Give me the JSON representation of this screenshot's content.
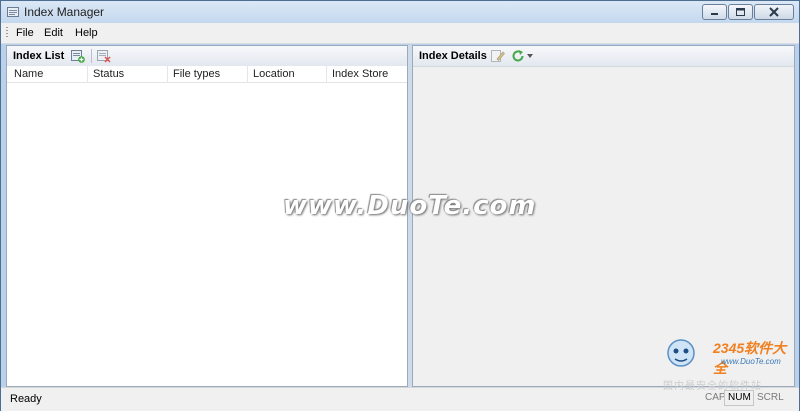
{
  "window": {
    "title": "Index Manager"
  },
  "menu": {
    "items": [
      "File",
      "Edit",
      "Help"
    ]
  },
  "left_pane": {
    "title": "Index List",
    "columns": [
      "Name",
      "Status",
      "File types",
      "Location",
      "Index Store"
    ]
  },
  "right_pane": {
    "title": "Index Details"
  },
  "status_bar": {
    "text": "Ready",
    "indicators": {
      "cap": "CAP",
      "num": "NUM",
      "scrl": "SCRL"
    }
  },
  "watermark": {
    "main": "www.DuoTe.com",
    "corner_brand": "2345软件大全",
    "corner_url": "www.DuoTe.com",
    "corner_sub": "国内最安全的软件站"
  }
}
